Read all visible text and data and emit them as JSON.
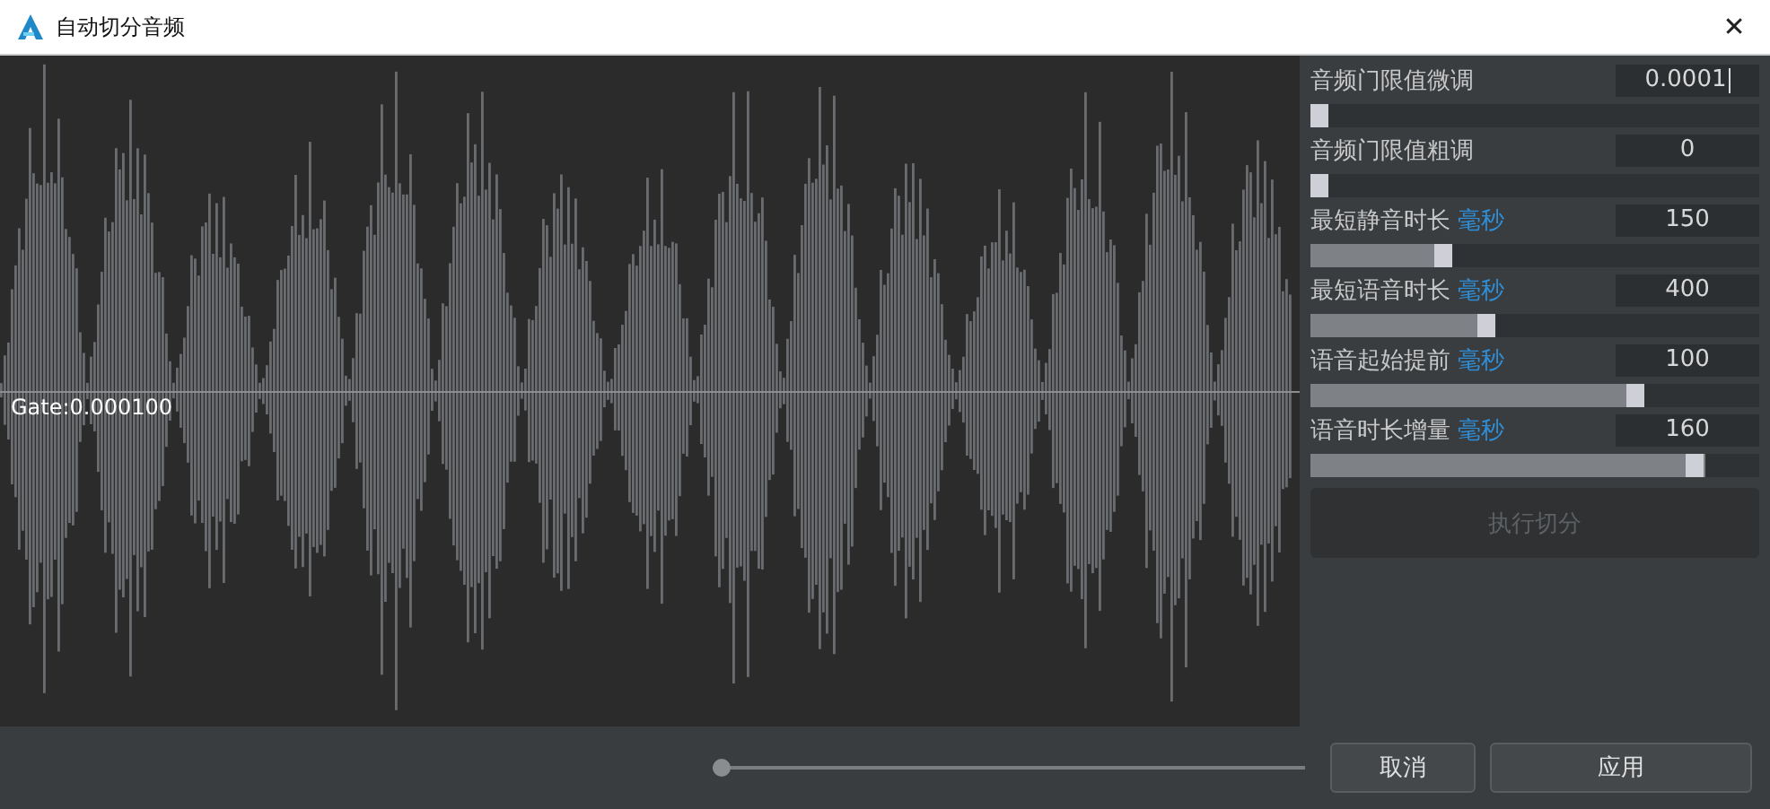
{
  "window": {
    "title": "自动切分音频",
    "close": "✕"
  },
  "waveform": {
    "gate_label": "Gate:0.000100"
  },
  "params": [
    {
      "label": "音频门限值微调",
      "value": "0.0001",
      "focused": true,
      "level": 0
    },
    {
      "label": "音频门限值粗调",
      "value": "0",
      "focused": false,
      "level": 0
    },
    {
      "label": "最短静音时长",
      "unit": "毫秒",
      "value": "150",
      "focused": false,
      "level": 0.29
    },
    {
      "label": "最短语音时长",
      "unit": "毫秒",
      "value": "400",
      "focused": false,
      "level": 0.39
    },
    {
      "label": "语音起始提前",
      "unit": "毫秒",
      "value": "100",
      "focused": false,
      "level": 0.74
    },
    {
      "label": "语音时长增量",
      "unit": "毫秒",
      "value": "160",
      "focused": false,
      "level": 0.88
    }
  ],
  "run_button": {
    "label": "执行切分",
    "disabled": true
  },
  "zoom_slider": {
    "level": 0
  },
  "buttons": [
    "取消",
    "应用"
  ]
}
